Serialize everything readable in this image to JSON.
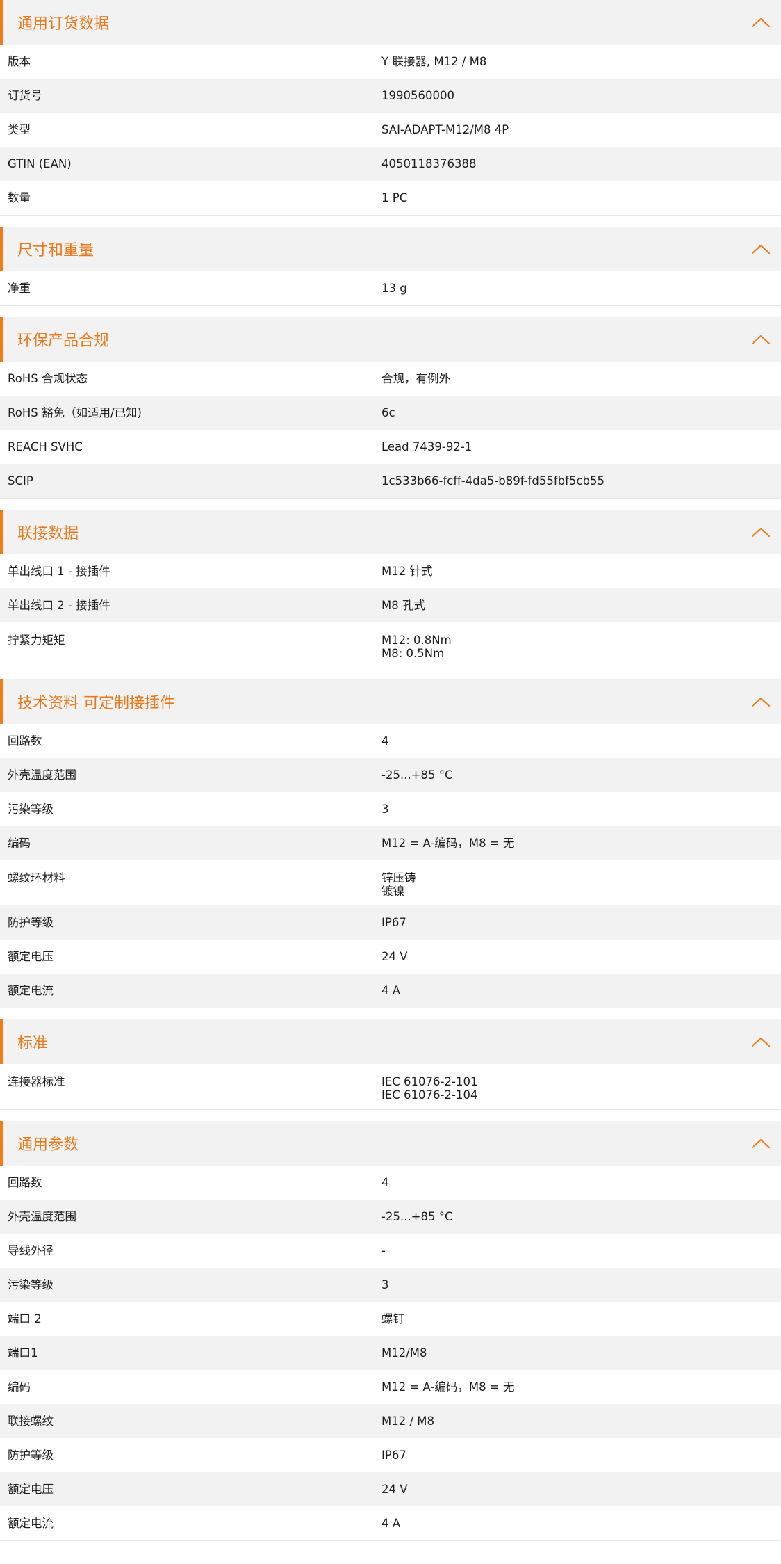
{
  "theme": {
    "accent": "#f07c1b",
    "title_color": "#e87a1d",
    "header_bg": "#f2f2f2",
    "stripe_bg": "#f2f2f2",
    "text_color": "#1e1e1e"
  },
  "sections": [
    {
      "title": "通用订货数据",
      "icon": "chevron-up-icon",
      "rows": [
        {
          "label": "版本",
          "value": "Y 联接器, M12 / M8"
        },
        {
          "label": "订货号",
          "value": "1990560000"
        },
        {
          "label": "类型",
          "value": "SAI-ADAPT-M12/M8 4P"
        },
        {
          "label": "GTIN (EAN)",
          "value": "4050118376388"
        },
        {
          "label": "数量",
          "value": "1  PC"
        }
      ]
    },
    {
      "title": "尺寸和重量",
      "icon": "chevron-up-icon",
      "rows": [
        {
          "label": "净重",
          "value": "13  g"
        }
      ]
    },
    {
      "title": "环保产品合规",
      "icon": "chevron-up-icon",
      "rows": [
        {
          "label": "RoHS 合规状态",
          "value": "合规，有例外"
        },
        {
          "label": "RoHS 豁免（如适用/已知)",
          "value": "6c"
        },
        {
          "label": "REACH SVHC",
          "value": "Lead 7439-92-1"
        },
        {
          "label": "SCIP",
          "value": "1c533b66-fcff-4da5-b89f-fd55fbf5cb55"
        }
      ]
    },
    {
      "title": "联接数据",
      "icon": "chevron-up-icon",
      "rows": [
        {
          "label": "单出线口 1 - 接插件",
          "value": "M12 针式"
        },
        {
          "label": "单出线口 2 - 接插件",
          "value": "M8 孔式"
        },
        {
          "label": "拧紧力矩矩",
          "value": "M12: 0.8Nm\nM8: 0.5Nm"
        }
      ]
    },
    {
      "title": "技术资料 可定制接插件",
      "icon": "chevron-up-icon",
      "rows": [
        {
          "label": "回路数",
          "value": "4"
        },
        {
          "label": "外壳温度范围",
          "value": "-25...+85 °C"
        },
        {
          "label": "污染等级",
          "value": "3"
        },
        {
          "label": "编码",
          "value": "M12 = A-编码，M8 = 无"
        },
        {
          "label": "螺纹环材料",
          "value": "锌压铸\n镀镍"
        },
        {
          "label": "防护等级",
          "value": "IP67"
        },
        {
          "label": "额定电压",
          "value": "24  V"
        },
        {
          "label": "额定电流",
          "value": "4  A"
        }
      ]
    },
    {
      "title": "标准",
      "icon": "chevron-up-icon",
      "rows": [
        {
          "label": "连接器标准",
          "value": "IEC 61076-2-101\nIEC 61076-2-104"
        }
      ]
    },
    {
      "title": "通用参数",
      "icon": "chevron-up-icon",
      "rows": [
        {
          "label": "回路数",
          "value": "4"
        },
        {
          "label": "外壳温度范围",
          "value": "-25...+85 °C"
        },
        {
          "label": "导线外径",
          "value": "-"
        },
        {
          "label": "污染等级",
          "value": "3"
        },
        {
          "label": "端口 2",
          "value": "螺钉"
        },
        {
          "label": "端口1",
          "value": "M12/M8"
        },
        {
          "label": "编码",
          "value": "M12 = A-编码，M8 = 无"
        },
        {
          "label": "联接螺纹",
          "value": "M12 / M8"
        },
        {
          "label": "防护等级",
          "value": "IP67"
        },
        {
          "label": "额定电压",
          "value": "24  V"
        },
        {
          "label": "额定电流",
          "value": "4  A"
        }
      ]
    }
  ]
}
